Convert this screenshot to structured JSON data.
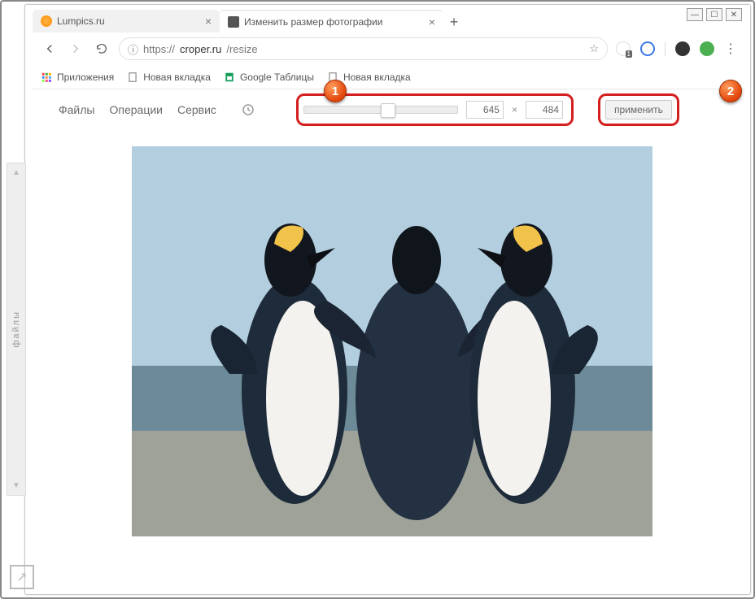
{
  "window": {
    "controls": {
      "min": "—",
      "max": "☐",
      "close": "✕"
    }
  },
  "tabs": {
    "items": [
      {
        "title": "Lumpics.ru"
      },
      {
        "title": "Изменить размер фотографии"
      }
    ],
    "new_tab": "+"
  },
  "urlbar": {
    "info_icon": "ⓘ",
    "scheme": "https://",
    "host": "croper.ru",
    "path": "/resize",
    "star": "☆"
  },
  "bookmarks": {
    "apps": "Приложения",
    "items": [
      "Новая вкладка",
      "Google Таблицы",
      "Новая вкладка"
    ]
  },
  "app": {
    "menu": [
      "Файлы",
      "Операции",
      "Сервис"
    ],
    "width": "645",
    "height": "484",
    "sep": "×",
    "apply": "применить"
  },
  "sidebar": {
    "label": "файлы",
    "up": "▲",
    "down": "▼"
  },
  "markers": {
    "one": "1",
    "two": "2"
  },
  "bottom_icon": "↗"
}
